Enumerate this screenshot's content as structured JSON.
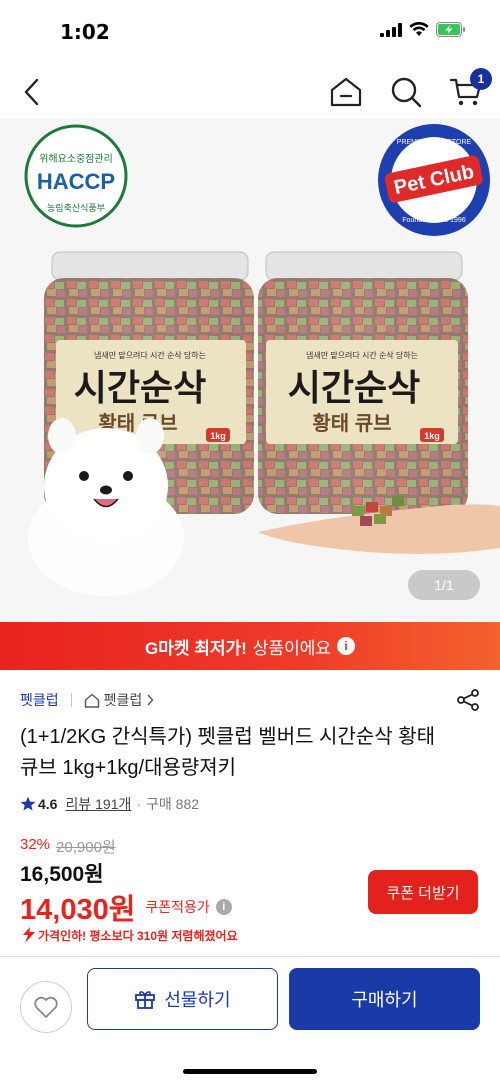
{
  "status": {
    "time": "1:02",
    "icons": [
      "signal-icon",
      "wifi-icon",
      "battery-charging-icon"
    ],
    "battery_color": "#36c759"
  },
  "nav": {
    "icons": [
      "back-icon",
      "home-icon",
      "search-icon",
      "cart-icon"
    ],
    "cart_count": "1"
  },
  "product_image": {
    "haccp_badge": {
      "top_text": "위해요소중점관리",
      "main_text": "HACCP",
      "bottom_text": "농림축산식품부"
    },
    "brand_logo": {
      "ring_text_top": "PREMIUM PET STORE",
      "main_text": "Pet Club",
      "ring_text_bottom": "Founded since 1996"
    },
    "jar_label": {
      "tagline": "냄새만 맡으려다 시간 순삭 당하는",
      "title": "시간순삭",
      "subtitle": "황태 큐브",
      "weight": "1kg"
    },
    "counter": "1/1"
  },
  "promo": {
    "strong": "G마켓 최저가!",
    "text": "상품이에요",
    "info_icon": "i"
  },
  "seller": {
    "name": "펫클럽",
    "store_link": "펫클럽"
  },
  "product": {
    "title": "(1+1/2KG 간식특가) 펫클럽 벨버드 시간순삭 황태큐브 1kg+1kg/대용량져키",
    "rating": "4.6",
    "reviews": "리뷰 191개",
    "purchases": "구매 882",
    "discount_rate": "32%",
    "original_price": "20,900원",
    "sale_price": "16,500원",
    "coupon_price": "14,030원",
    "coupon_label": "쿠폰적용가",
    "coupon_button": "쿠폰 더받기",
    "price_drop": "가격인하! 평소보다 310원 저렴해졌어요"
  },
  "bottom": {
    "gift_label": "선물하기",
    "buy_label": "구매하기"
  },
  "colors": {
    "accent_blue": "#1a3aa8",
    "accent_red": "#e8231e",
    "cart_badge": "#1a2f9e"
  }
}
